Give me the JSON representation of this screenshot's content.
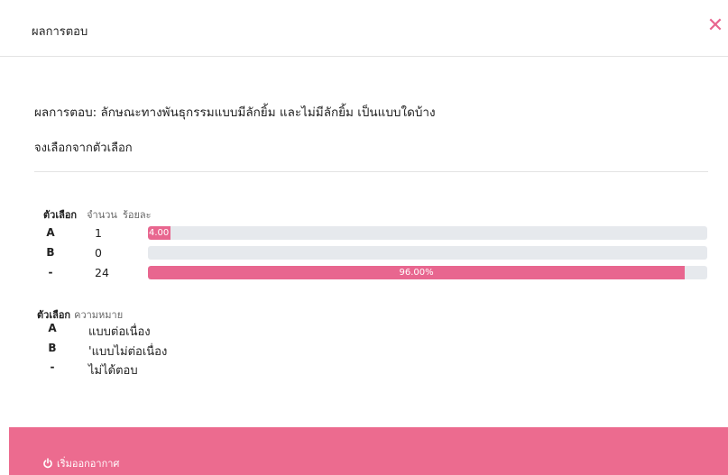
{
  "dialog": {
    "title": "ผลการตอบ",
    "close_icon": "close-x-icon",
    "accent_color": "#e8668f"
  },
  "question": {
    "text": "ผลการตอบ: ลักษณะทางพันธุกรรมแบบมีลักยิ้ม และไม่มีลักยิ้ม เป็นแบบใดบ้าง",
    "instruction": "จงเลือกจากตัวเลือก"
  },
  "stats": {
    "headers": {
      "option": "ตัวเลือก",
      "count": "จำนวน",
      "percent": "ร้อยละ"
    },
    "rows": [
      {
        "option": "A",
        "count": "1",
        "percent_label": "4.00",
        "percent": 4
      },
      {
        "option": "B",
        "count": "0",
        "percent_label": "",
        "percent": 0
      },
      {
        "option": "-",
        "count": "24",
        "percent_label": "96.00%",
        "percent": 96
      }
    ]
  },
  "legend": {
    "headers": {
      "option": "ตัวเลือก",
      "meaning": "ความหมาย"
    },
    "rows": [
      {
        "option": "A",
        "meaning": "แบบต่อเนื่อง"
      },
      {
        "option": "B",
        "meaning": "'แบบไม่ต่อเนื่อง"
      },
      {
        "option": "-",
        "meaning": "ไม่ได้ตอบ"
      }
    ]
  },
  "footer": {
    "button_label": "เริ่มออกอากาศ",
    "button_icon": "power-icon",
    "background_color": "#ec6b8f"
  }
}
